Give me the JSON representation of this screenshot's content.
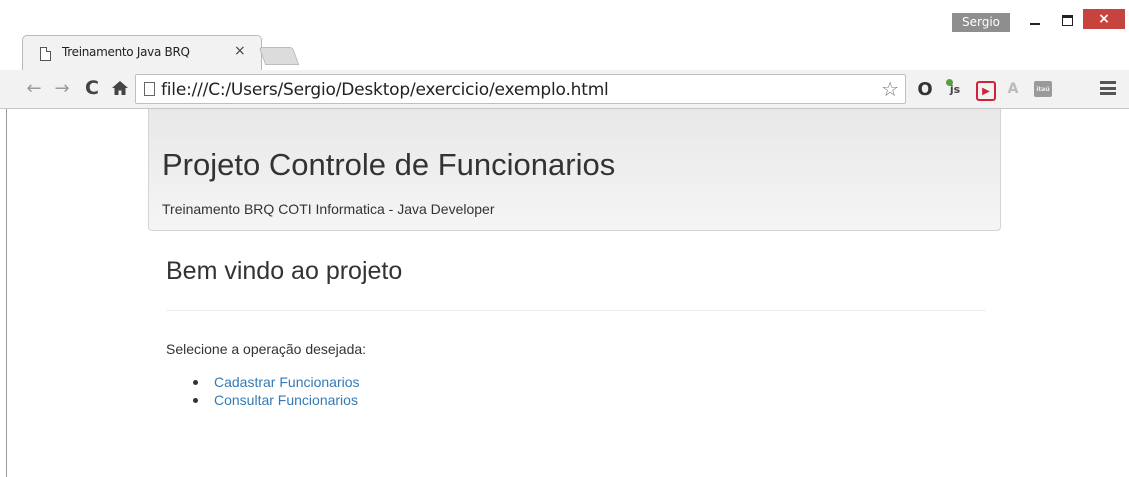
{
  "window": {
    "user": "Sergio",
    "minimize": "_",
    "maximize": "□",
    "close": "×"
  },
  "tabs": [
    {
      "label": "Treinamento Java BRQ",
      "close": "×",
      "active": true
    }
  ],
  "toolbar": {
    "back": "←",
    "forward": "→",
    "reload": "C",
    "home": "⌂",
    "url": "file:///C:/Users/Sergio/Desktop/exercicio/exemplo.html",
    "star": "☆",
    "extensions": [
      {
        "icon": "opera-icon",
        "glyph": "O"
      },
      {
        "icon": "js-icon",
        "glyph": "js"
      },
      {
        "icon": "play-icon",
        "glyph": "▶"
      },
      {
        "icon": "angular-icon",
        "glyph": "A"
      },
      {
        "icon": "itau-icon",
        "glyph": "itaú"
      }
    ],
    "menu_icon": "hamburger-menu-icon"
  },
  "page": {
    "title": "Projeto Controle de Funcionarios",
    "subtitle": "Treinamento BRQ COTI Informatica - Java Developer",
    "welcome": "Bem vindo ao projeto",
    "instruction": "Selecione a operação desejada:",
    "links": [
      {
        "label": "Cadastrar Funcionarios"
      },
      {
        "label": "Consultar Funcionarios"
      }
    ]
  },
  "colors": {
    "link": "#337ab7",
    "text": "#333333",
    "close_button": "#c7443e",
    "toolbar_bg": "#f2f2f2"
  }
}
